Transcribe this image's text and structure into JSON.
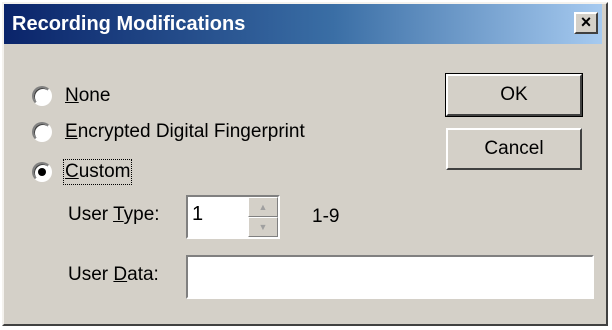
{
  "dialog": {
    "title": "Recording Modifications",
    "close_glyph": "×"
  },
  "options": [
    {
      "pre": "",
      "ul": "N",
      "post": "one",
      "checked": false
    },
    {
      "pre": "",
      "ul": "E",
      "post": "ncrypted Digital Fingerprint",
      "checked": false
    },
    {
      "pre": "",
      "ul": "C",
      "post": "ustom",
      "checked": true
    }
  ],
  "buttons": {
    "ok": "OK",
    "cancel": "Cancel"
  },
  "user_type": {
    "label_pre": "User ",
    "label_ul": "T",
    "label_post": "ype:",
    "value": "1",
    "range": "1-9",
    "up_icon": "▲",
    "down_icon": "▼"
  },
  "user_data": {
    "label_pre": "User ",
    "label_ul": "D",
    "label_post": "ata:",
    "value": ""
  }
}
